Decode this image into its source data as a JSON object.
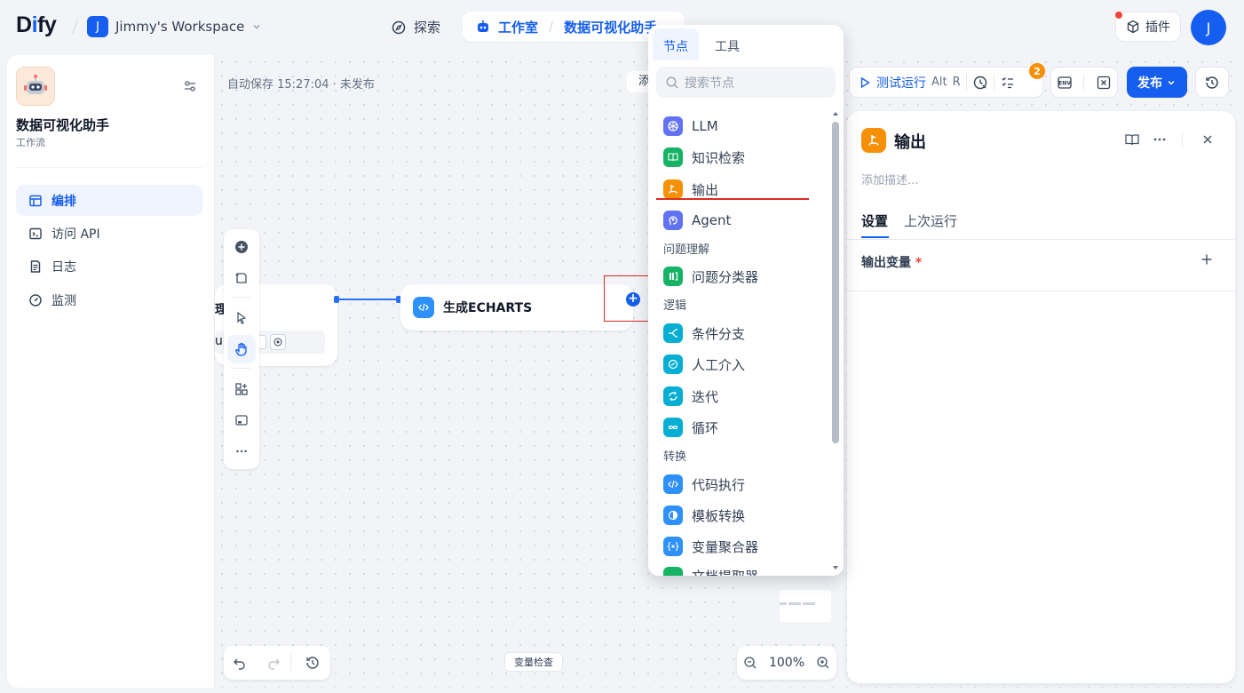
{
  "header": {
    "logo": {
      "pre": "D",
      "mid": "i",
      "post": "fy"
    },
    "workspace_initial": "J",
    "workspace_name": "Jimmy's Workspace",
    "explore_label": "探索",
    "studio_label": "工作室",
    "app_breadcrumb": "数据可视化助手",
    "plugins_label": "插件",
    "user_initial": "J"
  },
  "sidebar": {
    "app_name": "数据可视化助手",
    "app_type": "工作流",
    "items": [
      {
        "label": "编排",
        "icon": "layout-icon",
        "active": true
      },
      {
        "label": "访问 API",
        "icon": "terminal-icon",
        "active": false
      },
      {
        "label": "日志",
        "icon": "file-list-icon",
        "active": false
      },
      {
        "label": "监测",
        "icon": "gauge-icon",
        "active": false
      }
    ]
  },
  "canvas": {
    "autosave_text": "自动保存 15:27:04 · 未发布",
    "hidden_btn_char": "添",
    "prev_node_fragment": "理",
    "prev_node_fragment2": "u",
    "node_label": "生成ECHARTS",
    "variable_check": "变量检查",
    "zoom_level": "100%"
  },
  "toolbar": {
    "test_run_label": "测试运行",
    "shortcut_alt": "Alt",
    "shortcut_key": "R",
    "checklist_badge": "2",
    "publish_label": "发布"
  },
  "panel": {
    "title": "输出",
    "description_placeholder": "添加描述...",
    "tabs": [
      "设置",
      "上次运行"
    ],
    "output_var_label": "输出变量",
    "required_mark": "*"
  },
  "dropdown": {
    "tabs": [
      "节点",
      "工具"
    ],
    "search_placeholder": "搜索节点",
    "items": [
      {
        "label": "LLM",
        "color": "#6172f3",
        "icon": "llm-icon"
      },
      {
        "label": "知识检索",
        "color": "#16b364",
        "icon": "book-icon"
      },
      {
        "label": "输出",
        "color": "#f79009",
        "icon": "flag-icon"
      },
      {
        "label": "Agent",
        "color": "#6172f3",
        "icon": "agent-icon"
      },
      {
        "label": "问题分类器",
        "color": "#16b364",
        "icon": "classifier-icon"
      },
      {
        "label": "条件分支",
        "color": "#06aed4",
        "icon": "branch-icon"
      },
      {
        "label": "人工介入",
        "color": "#06aed4",
        "icon": "human-icon"
      },
      {
        "label": "迭代",
        "color": "#06aed4",
        "icon": "iteration-icon"
      },
      {
        "label": "循环",
        "color": "#06aed4",
        "icon": "loop-icon"
      },
      {
        "label": "代码执行",
        "color": "#2e90fa",
        "icon": "code-icon"
      },
      {
        "label": "模板转换",
        "color": "#2e90fa",
        "icon": "template-icon"
      },
      {
        "label": "变量聚合器",
        "color": "#2e90fa",
        "icon": "variable-icon"
      },
      {
        "label": "文档提取器",
        "color": "#16b364",
        "icon": "doc-extract-icon"
      }
    ],
    "categories": [
      "问题理解",
      "逻辑",
      "转换"
    ]
  }
}
